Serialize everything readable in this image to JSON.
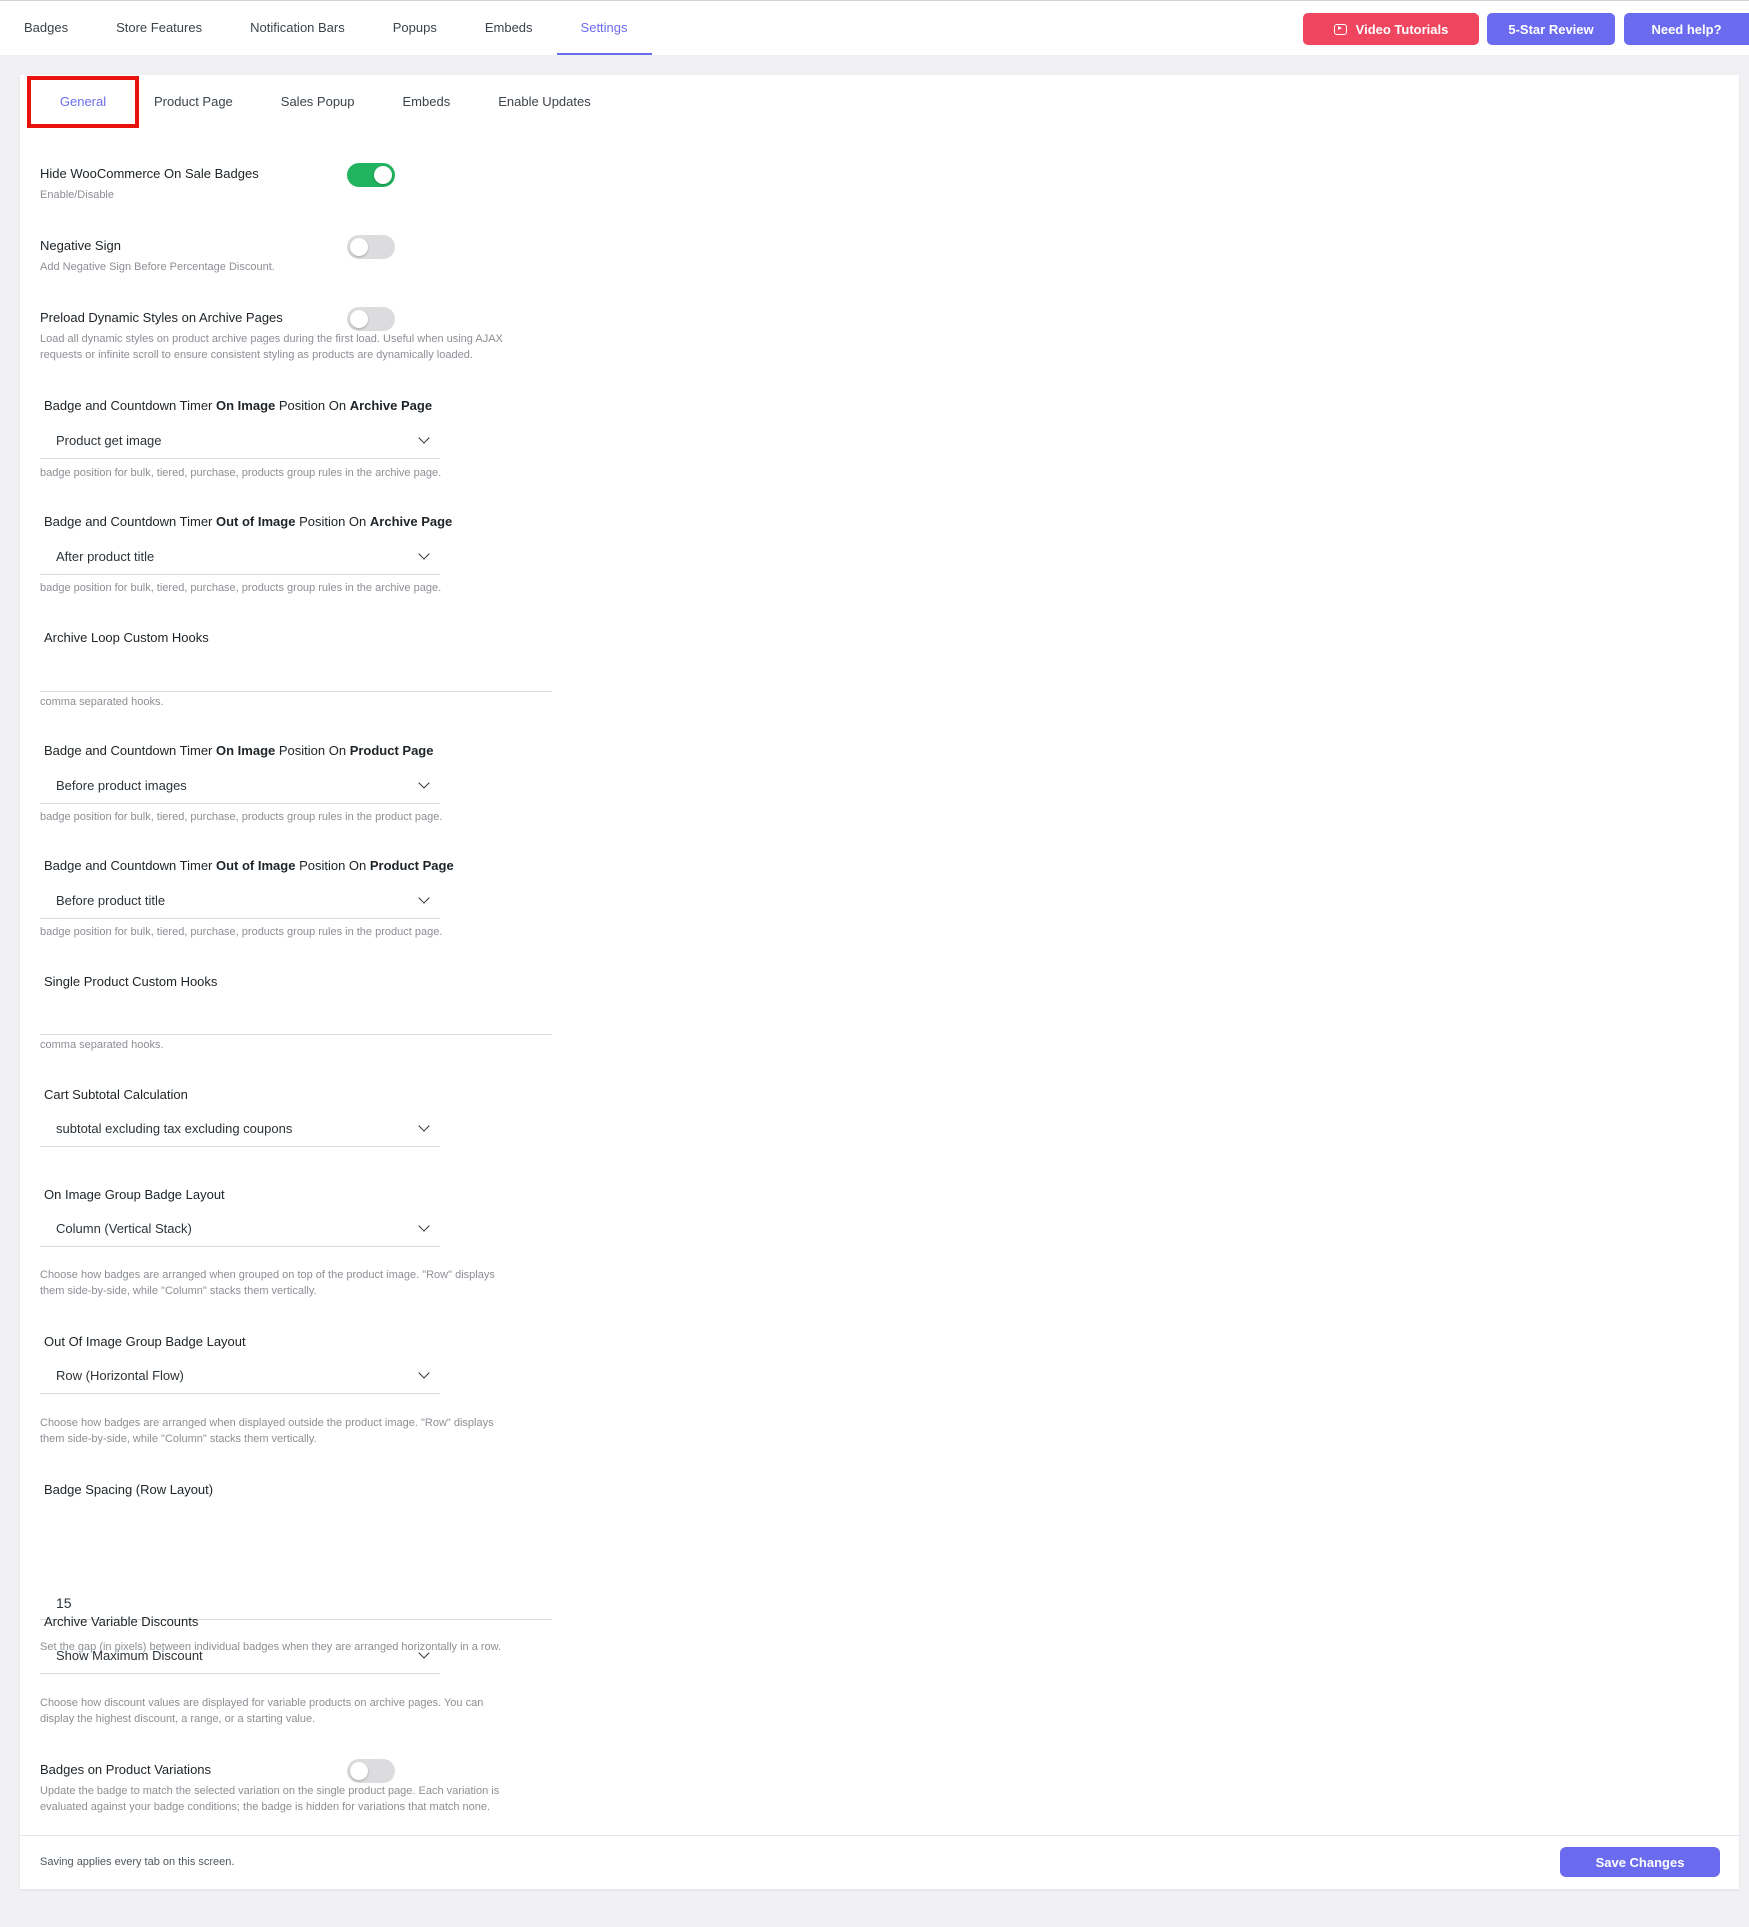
{
  "topnav": {
    "items": [
      {
        "label": "Badges",
        "active": false
      },
      {
        "label": "Store Features",
        "active": false
      },
      {
        "label": "Notification Bars",
        "active": false
      },
      {
        "label": "Popups",
        "active": false
      },
      {
        "label": "Embeds",
        "active": false
      },
      {
        "label": "Settings",
        "active": true
      }
    ],
    "video_tutorials": "Video Tutorials",
    "five_star_review": "5-Star Review",
    "need_help": "Need help?"
  },
  "subtabs": {
    "items": [
      {
        "label": "General",
        "active": true
      },
      {
        "label": "Product Page",
        "active": false
      },
      {
        "label": "Sales Popup",
        "active": false
      },
      {
        "label": "Embeds",
        "active": false
      },
      {
        "label": "Enable Updates",
        "active": false
      }
    ]
  },
  "settings": {
    "hide_sale_badges": {
      "label": "Hide WooCommerce On Sale Badges",
      "desc": "Enable/Disable",
      "enabled": true
    },
    "negative_sign": {
      "label": "Negative Sign",
      "desc": "Add Negative Sign Before Percentage Discount.",
      "enabled": false
    },
    "preload_styles": {
      "label": "Preload Dynamic Styles on Archive Pages",
      "desc_line1": "Load all dynamic styles on product archive pages during the first load. Useful when using AJAX",
      "desc_line2": "requests or infinite scroll to ensure consistent styling as products are dynamically loaded.",
      "enabled": false
    },
    "archive_on_image": {
      "label_parts": [
        "Badge and Countdown Timer ",
        "On Image",
        " Position On ",
        "Archive Page"
      ],
      "value": "Product get image",
      "desc": "badge position for bulk, tiered, purchase, products group rules in the archive page."
    },
    "archive_out_image": {
      "label_parts": [
        "Badge and Countdown Timer ",
        "Out of Image",
        " Position On ",
        "Archive Page"
      ],
      "value": "After product title",
      "desc": "badge position for bulk, tiered, purchase, products group rules in the archive page."
    },
    "archive_hooks": {
      "label": "Archive Loop Custom Hooks",
      "value": "",
      "desc": "comma separated hooks."
    },
    "product_on_image": {
      "label_parts": [
        "Badge and Countdown Timer ",
        "On Image",
        " Position On ",
        "Product Page"
      ],
      "value": "Before product images",
      "desc": "badge position for bulk, tiered, purchase, products group rules in the product page."
    },
    "product_out_image": {
      "label_parts": [
        "Badge and Countdown Timer ",
        "Out of Image",
        " Position On ",
        "Product Page"
      ],
      "value": "Before product title",
      "desc": "badge position for bulk, tiered, purchase, products group rules in the product page."
    },
    "product_hooks": {
      "label": "Single Product Custom Hooks",
      "value": "",
      "desc": "comma separated hooks."
    },
    "cart_subtotal": {
      "label": "Cart Subtotal Calculation",
      "value": "subtotal excluding tax excluding coupons"
    },
    "on_image_layout": {
      "label": "On Image Group Badge Layout",
      "value": "Column (Vertical Stack)",
      "desc_line1": "Choose how badges are arranged when grouped on top of the product image. \"Row\" displays",
      "desc_line2": "them side-by-side, while \"Column\" stacks them vertically."
    },
    "out_image_layout": {
      "label": "Out Of Image Group Badge Layout",
      "value": "Row (Horizontal Flow)",
      "desc_line1": "Choose how badges are arranged when displayed outside the product image. \"Row\" displays",
      "desc_line2": "them side-by-side, while \"Column\" stacks them vertically."
    },
    "badge_spacing": {
      "label": "Badge Spacing (Row Layout)",
      "value": "15",
      "desc": "Set the gap (in pixels) between individual badges when they are arranged horizontally in a row."
    },
    "archive_variable": {
      "label": "Archive Variable Discounts",
      "value": "Show Maximum Discount",
      "desc_line1": "Choose how discount values are displayed for variable products on archive pages. You can",
      "desc_line2": "display the highest discount, a range, or a starting value."
    },
    "badges_variations": {
      "label": "Badges on Product Variations",
      "desc_line1": "Update the badge to match the selected variation on the single product page. Each variation is",
      "desc_line2": "evaluated against your badge conditions; the badge is hidden for variations that match none.",
      "enabled": false
    }
  },
  "footer": {
    "note": "Saving applies every tab on this screen.",
    "save_label": "Save Changes"
  }
}
